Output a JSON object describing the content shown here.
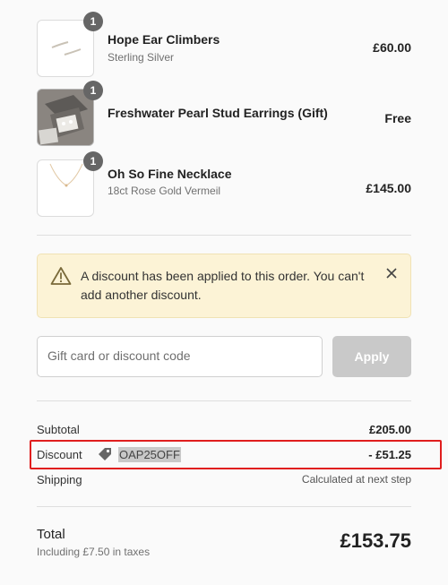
{
  "items": [
    {
      "qty": "1",
      "name": "Hope Ear Climbers",
      "variant": "Sterling Silver",
      "price": "£60.00"
    },
    {
      "qty": "1",
      "name": "Freshwater Pearl Stud Earrings (Gift)",
      "variant": "",
      "price": "Free"
    },
    {
      "qty": "1",
      "name": "Oh So Fine Necklace",
      "variant": "18ct Rose Gold Vermeil",
      "price": "£145.00"
    }
  ],
  "notice": {
    "text": "A discount has been applied to this order. You can't add another discount."
  },
  "discount_form": {
    "placeholder": "Gift card or discount code",
    "apply_label": "Apply"
  },
  "summary": {
    "subtotal_label": "Subtotal",
    "subtotal_value": "£205.00",
    "discount_label": "Discount",
    "discount_code": "OAP25OFF",
    "discount_value": "- £51.25",
    "shipping_label": "Shipping",
    "shipping_value": "Calculated at next step",
    "total_label": "Total",
    "total_sub": "Including £7.50 in taxes",
    "total_value": "£153.75"
  },
  "colors": {
    "notice_bg": "#fcf3d6",
    "highlight_border": "#e01e1e",
    "apply_disabled": "#c9c9c9"
  }
}
